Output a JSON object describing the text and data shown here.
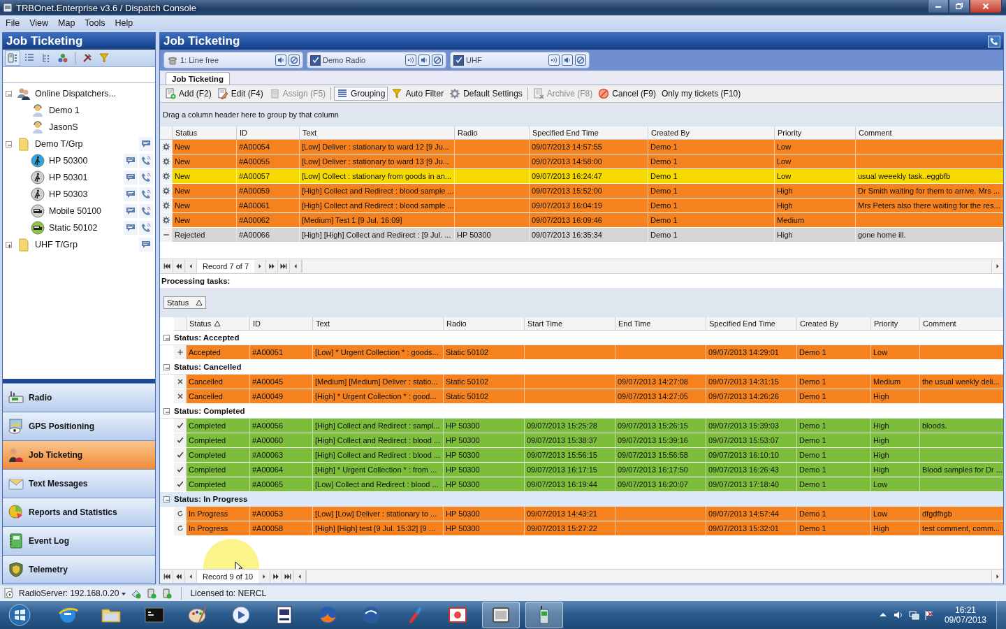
{
  "window": {
    "title": "TRBOnet.Enterprise v3.6 / Dispatch Console"
  },
  "menu": [
    "File",
    "View",
    "Map",
    "Tools",
    "Help"
  ],
  "left_panel": {
    "title": "Job Ticketing",
    "tools": [
      {
        "selected": true
      },
      {
        "selected": false
      },
      {
        "selected": false
      },
      {
        "selected": false
      },
      {
        "selected": false
      },
      {
        "selected": false
      }
    ],
    "tree": [
      {
        "label": "Online Dispatchers...",
        "kind": "dispatchers",
        "expanded": true,
        "children": [
          {
            "label": "Demo 1",
            "kind": "dispatcher"
          },
          {
            "label": "JasonS",
            "kind": "dispatcher"
          }
        ]
      },
      {
        "label": "Demo T/Grp",
        "kind": "group",
        "expanded": true,
        "children": [
          {
            "label": "HP 50300",
            "kind": "portable",
            "color": "#2aa6e0"
          },
          {
            "label": "HP 50301",
            "kind": "portable",
            "color": "#d0d0d0"
          },
          {
            "label": "HP 50303",
            "kind": "portable",
            "color": "#d0d0d0"
          },
          {
            "label": "Mobile 50100",
            "kind": "vehicle",
            "color": "#d0d0d0"
          },
          {
            "label": "Static 50102",
            "kind": "vehicle",
            "color": "#8cc63f"
          }
        ]
      },
      {
        "label": "UHF T/Grp",
        "kind": "group",
        "expanded": false
      }
    ],
    "nav": [
      {
        "label": "Radio",
        "selected": false
      },
      {
        "label": "GPS Positioning",
        "selected": false
      },
      {
        "label": "Job Ticketing",
        "selected": true
      },
      {
        "label": "Text Messages",
        "selected": false
      },
      {
        "label": "Reports and Statistics",
        "selected": false
      },
      {
        "label": "Event Log",
        "selected": false
      },
      {
        "label": "Telemetry",
        "selected": false
      }
    ]
  },
  "main": {
    "title": "Job Ticketing",
    "channels": [
      {
        "kind": "line",
        "label": "1: Line free"
      },
      {
        "kind": "radio",
        "label": "Demo Radio",
        "checked": true
      },
      {
        "kind": "radio",
        "label": "UHF",
        "checked": true
      }
    ],
    "tabs": [
      {
        "label": "Job Ticketing",
        "selected": true
      }
    ],
    "toolbar": [
      {
        "label": "Add (F2)",
        "disabled": false,
        "on": false
      },
      {
        "label": "Edit (F4)",
        "disabled": false,
        "on": false
      },
      {
        "label": "Assign (F5)",
        "disabled": true,
        "on": false
      },
      {
        "label": "Grouping",
        "disabled": false,
        "on": true
      },
      {
        "label": "Auto Filter",
        "disabled": false,
        "on": false
      },
      {
        "label": "Default Settings",
        "disabled": false,
        "on": false
      },
      {
        "label": "Archive (F8)",
        "disabled": true,
        "on": false
      },
      {
        "label": "Cancel (F9)",
        "disabled": false,
        "on": false
      },
      {
        "label": "Only my tickets (F10)",
        "disabled": false,
        "on": false
      }
    ],
    "group_hint": "Drag a column header here to group by that column",
    "tickets": {
      "columns": [
        "Status",
        "ID",
        "Text",
        "Radio",
        "Specified End Time",
        "Created By",
        "Priority",
        "Comment"
      ],
      "rows": [
        {
          "kind": "new",
          "color": "#f5821f",
          "cells": [
            "New",
            "#A00054",
            "[Low] Deliver : stationary to ward 12 [9 Ju...",
            null,
            "09/07/2013 14:57:55",
            "Demo 1",
            "Low",
            null
          ]
        },
        {
          "kind": "new",
          "color": "#f5821f",
          "cells": [
            "New",
            "#A00055",
            "[Low] Deliver : stationary to ward 13 [9 Ju...",
            null,
            "09/07/2013 14:58:00",
            "Demo 1",
            "Low",
            null
          ]
        },
        {
          "kind": "new",
          "color": "#f7da00",
          "cells": [
            "New",
            "#A00057",
            "[Low] Collect : stationary from goods in an...",
            null,
            "09/07/2013 16:24:47",
            "Demo 1",
            "Low",
            "usual weeekly task..eggbfb"
          ]
        },
        {
          "kind": "new",
          "color": "#f5821f",
          "cells": [
            "New",
            "#A00059",
            "[High] Collect and Redirect : blood sample ...",
            null,
            "09/07/2013 15:52:00",
            "Demo 1",
            "High",
            "Dr Smith waiting for them to arrive. Mrs ..."
          ]
        },
        {
          "kind": "new",
          "color": "#f5821f",
          "cells": [
            "New",
            "#A00061",
            "[High] Collect and Redirect : blood sample ...",
            null,
            "09/07/2013 16:04:19",
            "Demo 1",
            "High",
            "Mrs Peters also there waiting for the res..."
          ]
        },
        {
          "kind": "new",
          "color": "#f5821f",
          "cells": [
            "New",
            "#A00062",
            "[Medium] Test 1 [9 Jul. 16:09]",
            null,
            "09/07/2013 16:09:46",
            "Demo 1",
            "Medium",
            null
          ]
        },
        {
          "kind": "rejected",
          "color": "#d5d5d5",
          "cells": [
            "Rejected",
            "#A00066",
            "[High] [High] Collect and Redirect : [9 Jul. ...",
            "HP 50300",
            "09/07/2013 16:35:34",
            "Demo 1",
            "High",
            "gone home ill."
          ]
        }
      ],
      "navigator": "Record 7 of 7"
    },
    "processing_label": "Processing tasks:",
    "group_by": [
      {
        "label": "Status",
        "sorted": true
      }
    ],
    "tasks": {
      "columns": [
        {
          "label": "Status",
          "sorted": true
        },
        {
          "label": "ID",
          "sorted": false
        },
        {
          "label": "Text",
          "sorted": false
        },
        {
          "label": "Radio",
          "sorted": false
        },
        {
          "label": "Start Time",
          "sorted": false
        },
        {
          "label": "End Time",
          "sorted": false
        },
        {
          "label": "Specified End Time",
          "sorted": false
        },
        {
          "label": "Created By",
          "sorted": false
        },
        {
          "label": "Priority",
          "sorted": false
        },
        {
          "label": "Comment",
          "sorted": false
        }
      ],
      "groups": [
        {
          "label": "Status: Accepted",
          "expanded": true,
          "selected": false,
          "rows": [
            {
              "kind": "accepted",
              "color": "#f5821f",
              "cells": [
                "Accepted",
                "#A00051",
                "[Low] * Urgent Collection * : goods...",
                "Static 50102",
                null,
                null,
                "09/07/2013 14:29:01",
                "Demo 1",
                "Low",
                null
              ]
            }
          ]
        },
        {
          "label": "Status: Cancelled",
          "expanded": true,
          "selected": false,
          "rows": [
            {
              "kind": "cancelled",
              "color": "#f5821f",
              "cells": [
                "Cancelled",
                "#A00045",
                "[Medium] [Medium] Deliver : statio...",
                "Static 50102",
                null,
                "09/07/2013 14:27:08",
                "09/07/2013 14:31:15",
                "Demo 1",
                "Medium",
                "the usual weekly deli..."
              ]
            },
            {
              "kind": "cancelled",
              "color": "#f5821f",
              "cells": [
                "Cancelled",
                "#A00049",
                "[High] * Urgent Collection * : good...",
                "Static 50102",
                null,
                "09/07/2013 14:27:05",
                "09/07/2013 14:26:26",
                "Demo 1",
                "High",
                null
              ]
            }
          ]
        },
        {
          "label": "Status: Completed",
          "expanded": true,
          "selected": false,
          "rows": [
            {
              "kind": "completed",
              "color": "#7cbd3c",
              "cells": [
                "Completed",
                "#A00056",
                "[High] Collect and Redirect : sampl...",
                "HP 50300",
                "09/07/2013 15:25:28",
                "09/07/2013 15:26:15",
                "09/07/2013 15:39:03",
                "Demo 1",
                "High",
                "bloods."
              ]
            },
            {
              "kind": "completed",
              "color": "#7cbd3c",
              "cells": [
                "Completed",
                "#A00060",
                "[High] Collect and Redirect : blood ...",
                "HP 50300",
                "09/07/2013 15:38:37",
                "09/07/2013 15:39:16",
                "09/07/2013 15:53:07",
                "Demo 1",
                "High",
                null
              ]
            },
            {
              "kind": "completed",
              "color": "#7cbd3c",
              "cells": [
                "Completed",
                "#A00063",
                "[High] Collect and Redirect : blood ...",
                "HP 50300",
                "09/07/2013 15:56:15",
                "09/07/2013 15:56:58",
                "09/07/2013 16:10:10",
                "Demo 1",
                "High",
                null
              ]
            },
            {
              "kind": "completed",
              "color": "#7cbd3c",
              "cells": [
                "Completed",
                "#A00064",
                "[High] * Urgent Collection * : from ...",
                "HP 50300",
                "09/07/2013 16:17:15",
                "09/07/2013 16:17:50",
                "09/07/2013 16:26:43",
                "Demo 1",
                "High",
                "Blood samples for Dr ..."
              ]
            },
            {
              "kind": "completed",
              "color": "#7cbd3c",
              "cells": [
                "Completed",
                "#A00065",
                "[Low] Collect and Redirect : blood ...",
                "HP 50300",
                "09/07/2013 16:19:44",
                "09/07/2013 16:20:07",
                "09/07/2013 17:18:40",
                "Demo 1",
                "Low",
                null
              ]
            }
          ]
        },
        {
          "label": "Status: In Progress",
          "expanded": true,
          "selected": true,
          "rows": [
            {
              "kind": "in_progress",
              "color": "#f5821f",
              "cells": [
                "In Progress",
                "#A00053",
                "[Low] [Low] Deliver : stationary to ...",
                "HP 50300",
                "09/07/2013 14:43:21",
                null,
                "09/07/2013 14:57:44",
                "Demo 1",
                "Low",
                "dfgdfhgb"
              ]
            },
            {
              "kind": "in_progress",
              "color": "#f5821f",
              "cells": [
                "In Progress",
                "#A00058",
                "[High] [High] test [9 Jul. 15:32] [9 ...",
                "HP 50300",
                "09/07/2013 15:27:22",
                null,
                "09/07/2013 15:32:01",
                "Demo 1",
                "High",
                "test comment, comm..."
              ]
            }
          ]
        }
      ],
      "navigator": "Record 9 of 10"
    }
  },
  "status_bar": {
    "server": "RadioServer: 192.168.0.20",
    "license": "Licensed to: NERCL"
  },
  "taskbar": {
    "apps": [
      {
        "active": false
      },
      {
        "active": false
      },
      {
        "active": false
      },
      {
        "active": false
      },
      {
        "active": false
      },
      {
        "active": false
      },
      {
        "active": false
      },
      {
        "active": false
      },
      {
        "active": false
      },
      {
        "active": false
      },
      {
        "active": true
      },
      {
        "active": true
      }
    ],
    "time": "16:21",
    "date": "09/07/2013"
  }
}
